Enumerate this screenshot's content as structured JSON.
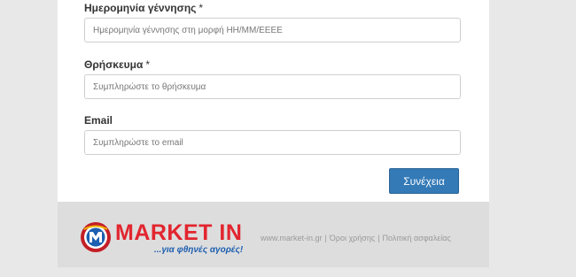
{
  "form": {
    "fields": [
      {
        "label": "Ημερομηνία γέννησης",
        "required": "*",
        "placeholder": "Ημερομηνία γέννησης στη μορφή ΗΗ/ΜΜ/ΕΕΕΕ"
      },
      {
        "label": "Θρήσκευμα",
        "required": "*",
        "placeholder": "Συμπληρώστε το θρήσκευμα"
      },
      {
        "label": "Email",
        "required": "",
        "placeholder": "Συμπληρώστε το email"
      }
    ],
    "submit_label": "Συνέχεια"
  },
  "footer": {
    "logo_text": "MARKET IN",
    "logo_tagline": "...για φθηνές αγορές!",
    "links": [
      "www.market-in.gr",
      "Όροι χρήσης",
      "Πολιτική ασφαλείας"
    ],
    "separator": "|"
  },
  "colors": {
    "accent": "#337ab7",
    "brand_red": "#e2252f",
    "brand_blue": "#1d5fb0"
  }
}
